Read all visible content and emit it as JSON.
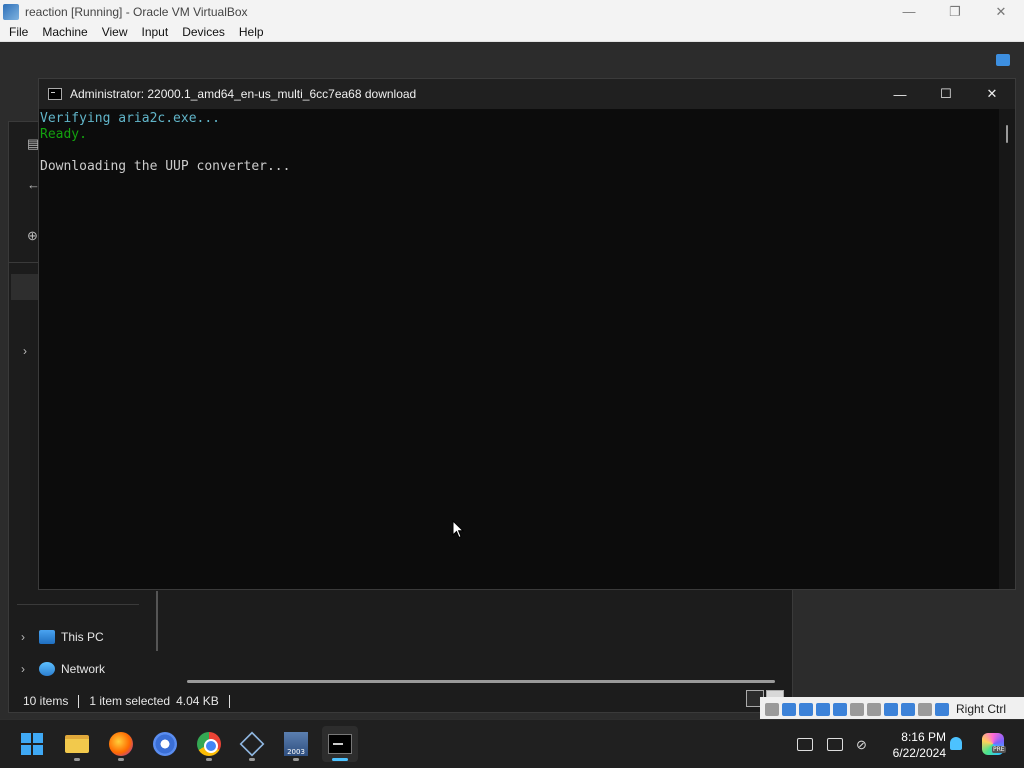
{
  "host_window": {
    "title": "reaction [Running] - Oracle VM VirtualBox",
    "controls": {
      "minimize": "—",
      "restore": "❐",
      "close": "✕"
    },
    "menu": [
      "File",
      "Machine",
      "View",
      "Input",
      "Devices",
      "Help"
    ]
  },
  "cmd_window": {
    "title": "Administrator:  22000.1_amd64_en-us_multi_6cc7ea68 download",
    "controls": {
      "minimize": "—",
      "maximize": "☐",
      "close": "✕"
    },
    "lines": [
      {
        "text": "Verifying aria2c.exe...",
        "color": "#61b5c9"
      },
      {
        "text": "Ready.",
        "color": "#13a10e"
      },
      {
        "text": "",
        "color": "#cccccc"
      },
      {
        "text": "Downloading the UUP converter...",
        "color": "#cccccc"
      }
    ]
  },
  "explorer": {
    "nav": [
      {
        "label": "This PC",
        "icon": "this-pc-icon"
      },
      {
        "label": "Network",
        "icon": "network-icon"
      }
    ],
    "status": {
      "items": "10 items",
      "selected": "1 item selected",
      "size": "4.04 KB"
    }
  },
  "vbox_statusbar": {
    "host_key": "Right Ctrl"
  },
  "taskbar": {
    "apps": [
      "start-button",
      "file-explorer",
      "firefox",
      "chromium",
      "chrome",
      "virtualbox",
      "visual-studio-2003",
      "terminal"
    ],
    "active_app": "terminal",
    "clock": {
      "time": "8:16 PM",
      "date": "6/22/2024"
    },
    "copilot_badge": "PRE"
  },
  "colors": {
    "terminal_bg": "#0c0c0c",
    "accent": "#4cc2ff",
    "ready_green": "#13a10e",
    "verify_teal": "#61b5c9"
  }
}
